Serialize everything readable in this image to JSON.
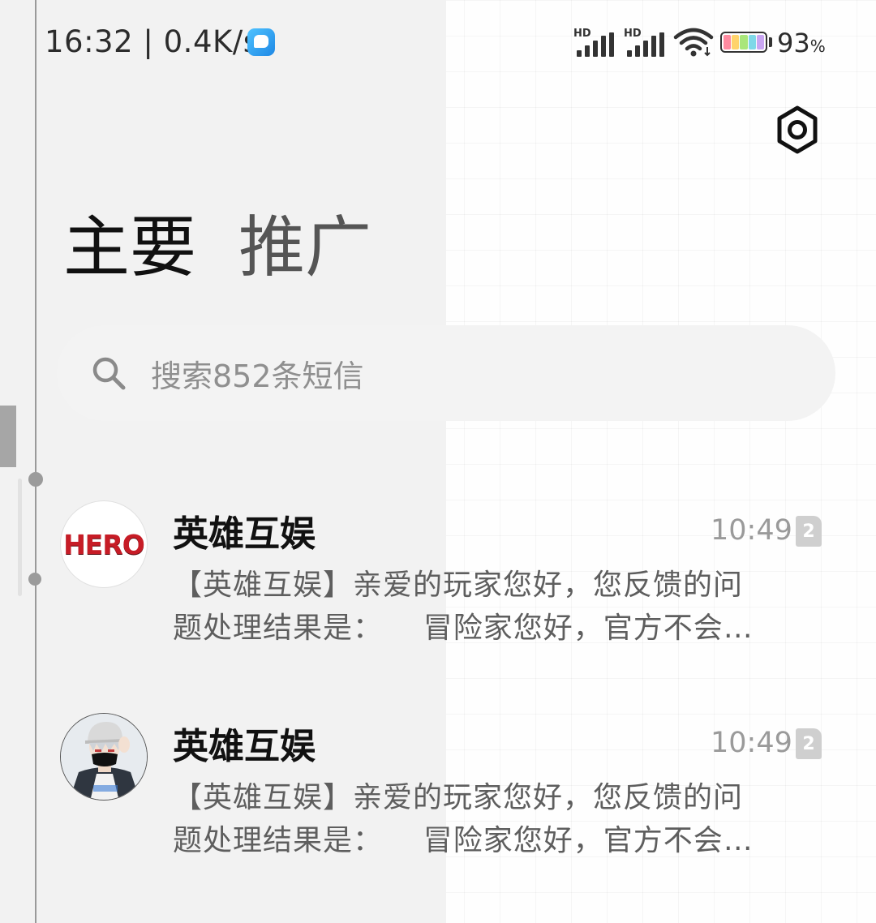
{
  "status_bar": {
    "time": "16:32",
    "network_speed": "0.4K/s",
    "signal_1_label": "HD",
    "signal_2_label": "HD",
    "battery_percent": "93",
    "battery_unit": "%"
  },
  "header": {
    "settings_icon": "settings-hexagon-icon"
  },
  "tabs": [
    {
      "label": "主要",
      "active": true
    },
    {
      "label": "推广",
      "active": false
    }
  ],
  "search": {
    "icon": "search-icon",
    "placeholder": "搜索852条短信"
  },
  "conversations": [
    {
      "avatar_text": "HERO",
      "sender": "英雄互娱",
      "time": "10:49",
      "sim_badge": "2",
      "preview_line_1": "【英雄互娱】亲爱的玩家您好，您反馈的问",
      "preview_line_2": "题处理结果是：    冒险家您好，官方不会…"
    },
    {
      "avatar_icon": "anime-character-avatar",
      "sender": "英雄互娱",
      "time": "10:49",
      "sim_badge": "2",
      "preview_line_1": "【英雄互娱】亲爱的玩家您好，您反馈的问",
      "preview_line_2": "题处理结果是：    冒险家您好，官方不会…"
    }
  ],
  "colors": {
    "accent_text": "#111111",
    "secondary_text": "#5e5e5e",
    "time_text": "#9a9a9a",
    "hero_red": "#c71c26"
  }
}
